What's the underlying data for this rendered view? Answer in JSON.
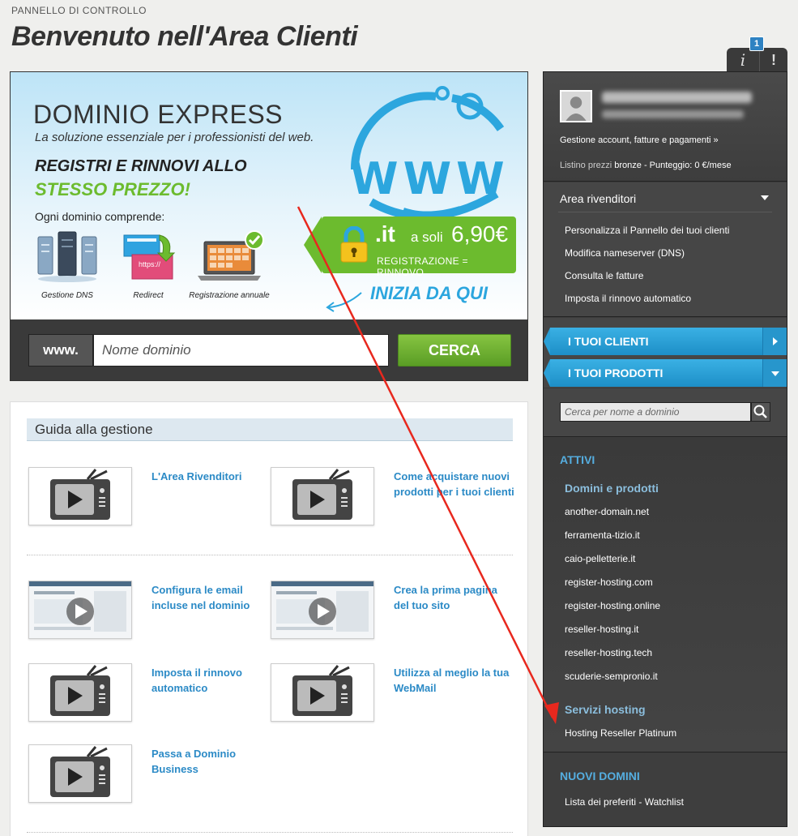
{
  "breadcrumb": "PANNELLO DI CONTROLLO",
  "page_title": "Benvenuto nell'Area Clienti",
  "top_tabs": {
    "info_label": "i",
    "info_badge": "1",
    "alert_label": "!"
  },
  "banner": {
    "title": "DOMINIO EXPRESS",
    "subtitle": "La soluzione essenziale per i professionisti del web.",
    "headline": "REGISTRI E RINNOVI ALLO",
    "headline_highlight": "STESSO PREZZO!",
    "includes_label": "Ogni dominio comprende:",
    "features": [
      "Gestione DNS",
      "Redirect",
      "Registrazione annuale"
    ],
    "redirect_text": "https://",
    "globe_text": "WWW",
    "price_ext": ".it",
    "price_prefix": "a soli",
    "price": "6,90€",
    "price_note": "REGISTRAZIONE = RINNOVO",
    "cta": "INIZIA DA QUI",
    "www_label": "www.",
    "search_placeholder": "Nome dominio",
    "search_button": "CERCA"
  },
  "guide": {
    "header": "Guida alla gestione",
    "videos": [
      {
        "title": "L'Area Rivenditori",
        "thumb": "tv"
      },
      {
        "title": "Come acquistare nuovi prodotti per i tuoi clienti",
        "thumb": "tv"
      },
      {
        "title": "Configura le email incluse nel dominio",
        "thumb": "screenshot"
      },
      {
        "title": "Crea la prima pagina del tuo sito",
        "thumb": "screenshot"
      },
      {
        "title": "Imposta il rinnovo automatico",
        "thumb": "tv"
      },
      {
        "title": "Utilizza al meglio la tua WebMail",
        "thumb": "tv"
      },
      {
        "title": "Passa a Dominio Business",
        "thumb": "tv"
      }
    ]
  },
  "sidebar": {
    "account": {
      "manage_link": "Gestione account, fatture e pagamenti »",
      "listino_prefix": "Listino prezzi",
      "listino_value": "bronze - Punteggio: 0 €/mese"
    },
    "reseller": {
      "title": "Area rivenditori",
      "items": [
        "Personalizza il Pannello dei tuoi clienti",
        "Modifica nameserver (DNS)",
        "Consulta le fatture",
        "Imposta il rinnovo automatico"
      ]
    },
    "tabs": [
      "I TUOI CLIENTI",
      "I TUOI PRODOTTI"
    ],
    "filter_placeholder": "Cerca per nome a dominio",
    "attivi": {
      "title": "ATTIVI",
      "domains_title": "Domini e prodotti",
      "domains": [
        "another-domain.net",
        "ferramenta-tizio.it",
        "caio-pelletterie.it",
        "register-hosting.com",
        "register-hosting.online",
        "reseller-hosting.it",
        "reseller-hosting.tech",
        "scuderie-sempronio.it"
      ],
      "hosting_title": "Servizi hosting",
      "hosting": [
        "Hosting Reseller Platinum"
      ]
    },
    "nuovi": {
      "title": "NUOVI DOMINI",
      "items": [
        "Lista dei preferiti - Watchlist"
      ]
    }
  },
  "colors": {
    "accent_blue": "#2b8ac6",
    "accent_green": "#6cbb2e",
    "sidebar_bg": "#3c3c3c",
    "annotation_arrow": "#e8281e"
  },
  "icons": [
    "user-avatar-icon",
    "search-icon",
    "tv-play-icon",
    "lock-icon",
    "globe-icon",
    "server-icon",
    "laptop-calendar-icon",
    "check-badge-icon",
    "chevron-down-icon",
    "chevron-right-icon"
  ]
}
